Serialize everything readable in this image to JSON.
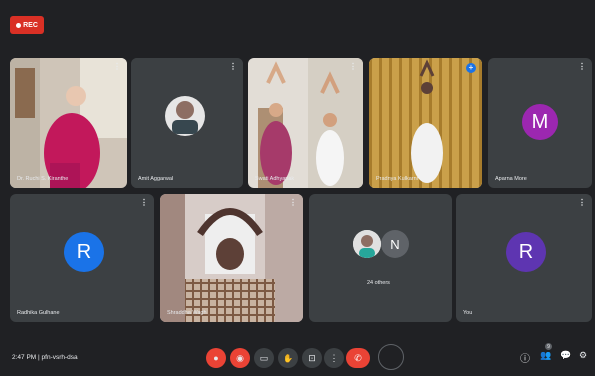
{
  "rec_label": "REC",
  "tiles": [
    {
      "name": "Dr. Ruchi S. Kiranthe"
    },
    {
      "name": "Amit Aggarwal"
    },
    {
      "name": "Swati Adhyapak"
    },
    {
      "name": "Pradnya Kulkarni"
    },
    {
      "name": "Aparna More",
      "initial": "M"
    },
    {
      "name": "Radhika Gulhane",
      "initial": "R"
    },
    {
      "name": "Shraddha Wagh"
    },
    {
      "name": "24 others",
      "initial": "N"
    },
    {
      "name": "You",
      "initial": "R"
    }
  ],
  "bottom": {
    "time": "2:47 PM",
    "meeting_code": "pfn-vsrh-dsa"
  },
  "colors": {
    "bg": "#202124",
    "tile": "#3c4043",
    "red": "#ea4335",
    "purple": "#9c27b0",
    "blue": "#1a73e8",
    "deep_purple": "#5e35b1",
    "gray_avatar": "#5f6368"
  },
  "icons": {
    "more": "⋮",
    "pin": "+",
    "mic": "🎙",
    "camera": "📷",
    "caption": "▭",
    "hand": "✋",
    "present": "⊡",
    "more_options": "⋮",
    "end_call": "✆",
    "info": "ⓘ",
    "people": "👥",
    "chat": "💬",
    "activities": "⚙"
  },
  "participant_badge": "9"
}
